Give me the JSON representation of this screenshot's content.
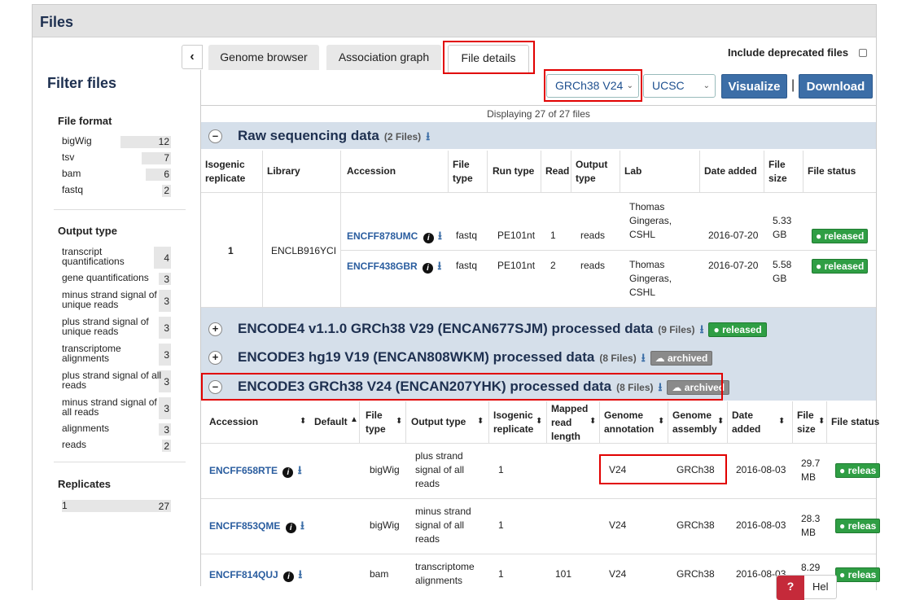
{
  "panel": {
    "title": "Files"
  },
  "facets": {
    "title": "Filter files",
    "file_format": {
      "heading": "File format",
      "items": [
        {
          "label": "bigWig",
          "count": "12",
          "fraction": 1.0
        },
        {
          "label": "tsv",
          "count": "7",
          "fraction": 0.58
        },
        {
          "label": "bam",
          "count": "6",
          "fraction": 0.5
        },
        {
          "label": "fastq",
          "count": "2",
          "fraction": 0.17
        }
      ]
    },
    "output_type": {
      "heading": "Output type",
      "items": [
        {
          "label": "transcript quantifications",
          "count": "4"
        },
        {
          "label": "gene quantifications",
          "count": "3"
        },
        {
          "label": "minus strand signal of unique reads",
          "count": "3"
        },
        {
          "label": "plus strand signal of unique reads",
          "count": "3"
        },
        {
          "label": "transcriptome alignments",
          "count": "3"
        },
        {
          "label": "plus strand signal of all reads",
          "count": "3"
        },
        {
          "label": "minus strand signal of all reads",
          "count": "3"
        },
        {
          "label": "alignments",
          "count": "3"
        },
        {
          "label": "reads",
          "count": "2"
        }
      ]
    },
    "replicates": {
      "heading": "Replicates",
      "items": [
        {
          "label": "1",
          "count": "27"
        }
      ]
    }
  },
  "tabs": {
    "collapse": "‹",
    "items": [
      {
        "label": "Genome browser"
      },
      {
        "label": "Association graph"
      },
      {
        "label": "File details"
      }
    ],
    "deprecated_label": "Include deprecated files"
  },
  "toolbar": {
    "assembly_select": "GRCh38 V24",
    "browser_select": "UCSC",
    "visualize_label": "Visualize",
    "separator": "|",
    "download_label": "Download",
    "displaying": "Displaying 27 of 27 files"
  },
  "raw": {
    "toggle": "–",
    "title": "Raw sequencing data",
    "count": "(2 Files)",
    "headers": {
      "iso": [
        "Isogenic",
        "replicate"
      ],
      "library": "Library",
      "accession": "Accession",
      "file_type": [
        "File",
        "type"
      ],
      "run_type": "Run type",
      "read": "Read",
      "output_type": [
        "Output",
        "type"
      ],
      "lab": "Lab",
      "date": "Date added",
      "size": [
        "File",
        "size"
      ],
      "status": "File status"
    },
    "replicate": "1",
    "library": "ENCLB916YCI",
    "rows": [
      {
        "accession": "ENCFF878UMC",
        "file_type": "fastq",
        "run_type": "PE101nt",
        "read": "1",
        "output_type": "reads",
        "lab": [
          "Thomas",
          "Gingeras,",
          "CSHL"
        ],
        "date": "2016-07-20",
        "size": [
          "5.33",
          "GB"
        ],
        "status": "released"
      },
      {
        "accession": "ENCFF438GBR",
        "file_type": "fastq",
        "run_type": "PE101nt",
        "read": "2",
        "output_type": "reads",
        "lab": [
          "Thomas",
          "Gingeras,",
          "CSHL"
        ],
        "date": "2016-07-20",
        "size": [
          "5.58",
          "GB"
        ],
        "status": "released"
      }
    ]
  },
  "groups": [
    {
      "toggle": "+",
      "title": "ENCODE4 v1.1.0 GRCh38 V29 (ENCAN677SJM) processed data",
      "count": "(9 Files)",
      "status": "released"
    },
    {
      "toggle": "+",
      "title": "ENCODE3 hg19 V19 (ENCAN808WKM) processed data",
      "count": "(8 Files)",
      "status": "archived"
    },
    {
      "toggle": "–",
      "title": "ENCODE3 GRCh38 V24 (ENCAN207YHK) processed data",
      "count": "(8 Files)",
      "status": "archived"
    }
  ],
  "proc": {
    "headers": {
      "accession": "Accession",
      "default": "Default",
      "file_type": [
        "File",
        "type"
      ],
      "output_type": "Output type",
      "iso": [
        "Isogenic",
        "replicate"
      ],
      "mapped": [
        "Mapped",
        "read",
        "length"
      ],
      "annotation": [
        "Genome",
        "annotation"
      ],
      "assembly": [
        "Genome",
        "assembly"
      ],
      "date": [
        "Date",
        "added"
      ],
      "size": [
        "File",
        "size"
      ],
      "status": "File status"
    },
    "rows": [
      {
        "accession": "ENCFF658RTE",
        "file_type": "bigWig",
        "output_type": [
          "plus strand",
          "signal of all",
          "reads"
        ],
        "iso": "1",
        "mapped": "",
        "annotation": "V24",
        "assembly": "GRCh38",
        "date": "2016-08-03",
        "size": [
          "29.7",
          "MB"
        ],
        "status": "releas"
      },
      {
        "accession": "ENCFF853QME",
        "file_type": "bigWig",
        "output_type": [
          "minus strand",
          "signal of all",
          "reads"
        ],
        "iso": "1",
        "mapped": "",
        "annotation": "V24",
        "assembly": "GRCh38",
        "date": "2016-08-03",
        "size": [
          "28.3",
          "MB"
        ],
        "status": "releas"
      },
      {
        "accession": "ENCFF814QUJ",
        "file_type": "bam",
        "output_type": [
          "transcriptome",
          "alignments"
        ],
        "iso": "1",
        "mapped": "101",
        "annotation": "V24",
        "assembly": "GRCh38",
        "date": "2016-08-03",
        "size": [
          "8.29",
          ""
        ],
        "status": "releas"
      }
    ]
  },
  "help": {
    "icon": "?",
    "label": "Hel"
  }
}
